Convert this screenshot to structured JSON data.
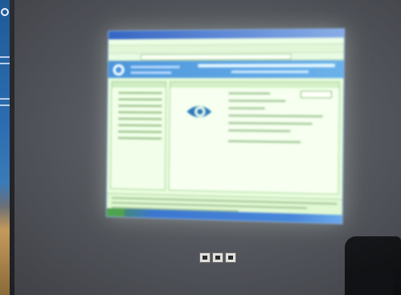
{
  "photo": {
    "subject": "projected-screen-in-room",
    "left_banner_color": "#2b6cb0",
    "projected_palette": {
      "window_bg": "#c8e3b8",
      "header": "#3d8cd8",
      "taskbar": "#2f6fd0"
    }
  }
}
